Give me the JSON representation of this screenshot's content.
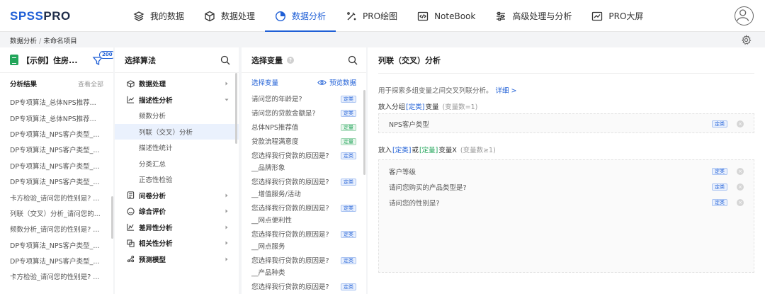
{
  "logo": {
    "part1": "SPSS",
    "part2": "PRO"
  },
  "nav": [
    {
      "label": "我的数据",
      "icon": "layers-icon",
      "active": false
    },
    {
      "label": "数据处理",
      "icon": "cube-icon",
      "active": false
    },
    {
      "label": "数据分析",
      "icon": "pie-chart-icon",
      "active": true
    },
    {
      "label": "PRO绘图",
      "icon": "magic-wand-icon",
      "active": false
    },
    {
      "label": "NoteBook",
      "icon": "code-icon",
      "active": false
    },
    {
      "label": "高级处理与分析",
      "icon": "sliders-icon",
      "active": false
    },
    {
      "label": "PRO大屏",
      "icon": "line-chart-icon",
      "active": false
    }
  ],
  "breadcrumb": {
    "parent": "数据分析",
    "separator": "/",
    "current": "未命名项目"
  },
  "data_panel": {
    "file_name": "【示例】住房...",
    "badge": "200",
    "results_title": "分析结果",
    "view_all": "查看全部",
    "results": [
      "DP专项算法_总体NPS推荐...",
      "DP专项算法_总体NPS推荐...",
      "DP专项算法_NPS客户类型_...",
      "DP专项算法_NPS客户类型_...",
      "DP专项算法_NPS客户类型_...",
      "DP专项算法_NPS客户类型_...",
      "卡方检验_请问您的性别是? ...",
      "列联（交叉）分析_请问您的...",
      "频数分析_请问您的性别是? ...",
      "DP专项算法_NPS客户类型_...",
      "DP专项算法_NPS客户类型_...",
      "卡方检验_请问您的性别是? ..."
    ]
  },
  "algo_panel": {
    "title": "选择算法",
    "items": [
      {
        "label": "数据处理",
        "level": "top",
        "icon": "cube-icon",
        "chevron": "right"
      },
      {
        "label": "描述性分析",
        "level": "top",
        "icon": "trend-icon",
        "chevron": "down"
      },
      {
        "label": "频数分析",
        "level": "sub"
      },
      {
        "label": "列联（交叉）分析",
        "level": "sub",
        "selected": true
      },
      {
        "label": "描述性统计",
        "level": "sub"
      },
      {
        "label": "分类汇总",
        "level": "sub"
      },
      {
        "label": "正态性检验",
        "level": "sub"
      },
      {
        "label": "问卷分析",
        "level": "top",
        "icon": "survey-icon",
        "chevron": "right"
      },
      {
        "label": "综合评价",
        "level": "top",
        "icon": "rating-icon",
        "chevron": "right"
      },
      {
        "label": "差异性分析",
        "level": "top",
        "icon": "diff-icon",
        "chevron": "right"
      },
      {
        "label": "相关性分析",
        "level": "top",
        "icon": "correlation-icon",
        "chevron": "right"
      },
      {
        "label": "预测模型",
        "level": "top",
        "icon": "predict-icon",
        "chevron": "right"
      }
    ]
  },
  "var_panel": {
    "title": "选择变量",
    "help": "?",
    "select_label": "选择变量",
    "preview_label": "预览数据",
    "tag_cls": "定类",
    "tag_num": "定量",
    "items": [
      {
        "lines": [
          "请问您的年龄是?"
        ],
        "tag": "cls"
      },
      {
        "lines": [
          "请问您的贷款金额是?"
        ],
        "tag": "cls"
      },
      {
        "lines": [
          "总体NPS推荐值"
        ],
        "tag": "num"
      },
      {
        "lines": [
          "贷款流程满意度"
        ],
        "tag": "num"
      },
      {
        "lines": [
          "您选择我行贷款的原因是?",
          "__品牌形象"
        ],
        "tag": "cls"
      },
      {
        "lines": [
          "您选择我行贷款的原因是?",
          "__增值服务/活动"
        ],
        "tag": "cls"
      },
      {
        "lines": [
          "您选择我行贷款的原因是?",
          "__网点便利性"
        ],
        "tag": "cls"
      },
      {
        "lines": [
          "您选择我行贷款的原因是?",
          "__网点服务"
        ],
        "tag": "cls"
      },
      {
        "lines": [
          "您选择我行贷款的原因是?",
          "__产品种类"
        ],
        "tag": "cls"
      },
      {
        "lines": [
          "您选择我行贷款的原因是?"
        ],
        "tag": "cls"
      }
    ]
  },
  "config_panel": {
    "title": "列联（交叉）分析",
    "description": "用于探索多组变量之间交叉列联分析。",
    "detail_link": "详细 >",
    "group_label": {
      "pre": "放入分组",
      "type": "[定类]",
      "post": "变量",
      "hint": "(变量数=1)"
    },
    "group_vars": [
      {
        "name": "NPS客户类型",
        "tag": "定类"
      }
    ],
    "x_label": {
      "pre": "放入",
      "type1": "[定类]",
      "or": "或",
      "type2": "[定量]",
      "post": "变量X",
      "hint": "(变量数≥1)"
    },
    "x_vars": [
      {
        "name": "客户等级",
        "tag": "定类"
      },
      {
        "name": "请问您购买的产品类型是?",
        "tag": "定类"
      },
      {
        "name": "请问您的性别是?",
        "tag": "定类"
      }
    ],
    "remove_glyph": "×"
  },
  "colors": {
    "accent": "#1f5fd6",
    "green": "#22a55a",
    "selected_bg": "#eaf1fd"
  }
}
